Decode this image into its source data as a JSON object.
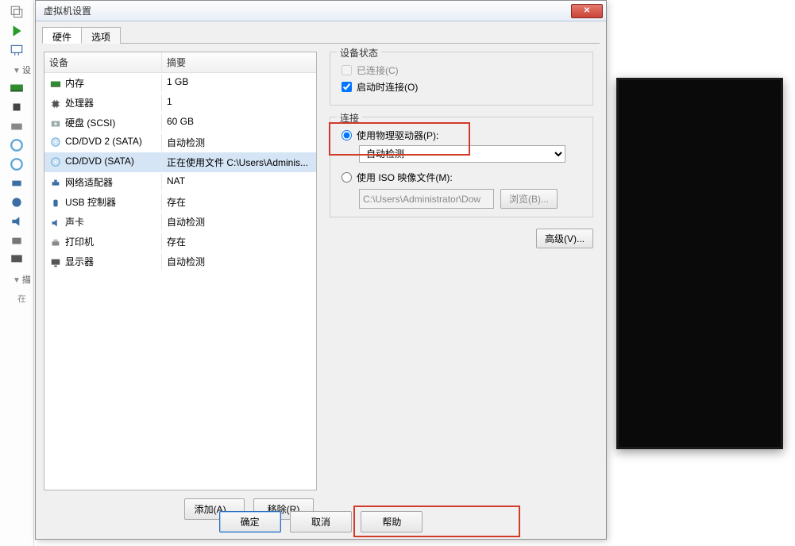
{
  "dialog": {
    "title": "虚拟机设置",
    "tabs": {
      "hardware": "硬件",
      "options": "选项"
    },
    "columns": {
      "device": "设备",
      "summary": "摘要"
    },
    "devices": [
      {
        "name": "内存",
        "summary": "1 GB",
        "icon": "mem"
      },
      {
        "name": "处理器",
        "summary": "1",
        "icon": "cpu"
      },
      {
        "name": "硬盘 (SCSI)",
        "summary": "60 GB",
        "icon": "hdd"
      },
      {
        "name": "CD/DVD 2 (SATA)",
        "summary": "自动检测",
        "icon": "cd"
      },
      {
        "name": "CD/DVD (SATA)",
        "summary": "正在使用文件 C:\\Users\\Adminis...",
        "icon": "cd",
        "selected": true
      },
      {
        "name": "网络适配器",
        "summary": "NAT",
        "icon": "net"
      },
      {
        "name": "USB 控制器",
        "summary": "存在",
        "icon": "usb"
      },
      {
        "name": "声卡",
        "summary": "自动检测",
        "icon": "snd"
      },
      {
        "name": "打印机",
        "summary": "存在",
        "icon": "prn"
      },
      {
        "name": "显示器",
        "summary": "自动检测",
        "icon": "disp"
      }
    ],
    "buttons": {
      "add": "添加(A)...",
      "remove": "移除(R)",
      "browse": "浏览(B)...",
      "advanced": "高级(V)...",
      "ok": "确定",
      "cancel": "取消",
      "help": "帮助"
    },
    "status_group": {
      "title": "设备状态",
      "connected": "已连接(C)",
      "connect_at_power": "启动时连接(O)"
    },
    "connect_group": {
      "title": "连接",
      "use_physical": "使用物理驱动器(P):",
      "physical_value": "自动检测",
      "use_iso": "使用 ISO 映像文件(M):",
      "iso_value": "C:\\Users\\Administrator\\Dow"
    }
  },
  "leftbar": {
    "label1": "设",
    "label2": "描",
    "label3": "在"
  }
}
